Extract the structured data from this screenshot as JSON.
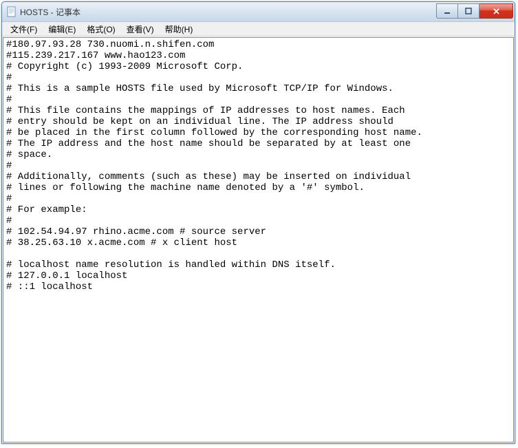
{
  "window": {
    "title": "HOSTS - 记事本"
  },
  "menu": {
    "file": "文件(F)",
    "edit": "编辑(E)",
    "format": "格式(O)",
    "view": "查看(V)",
    "help": "帮助(H)"
  },
  "content": "#180.97.93.28 730.nuomi.n.shifen.com\n#115.239.217.167 www.hao123.com\n# Copyright (c) 1993-2009 Microsoft Corp.\n#\n# This is a sample HOSTS file used by Microsoft TCP/IP for Windows.\n#\n# This file contains the mappings of IP addresses to host names. Each\n# entry should be kept on an individual line. The IP address should\n# be placed in the first column followed by the corresponding host name.\n# The IP address and the host name should be separated by at least one\n# space.\n#\n# Additionally, comments (such as these) may be inserted on individual\n# lines or following the machine name denoted by a '#' symbol.\n#\n# For example:\n#\n# 102.54.94.97 rhino.acme.com # source server\n# 38.25.63.10 x.acme.com # x client host\n\n# localhost name resolution is handled within DNS itself.\n# 127.0.0.1 localhost\n# ::1 localhost"
}
